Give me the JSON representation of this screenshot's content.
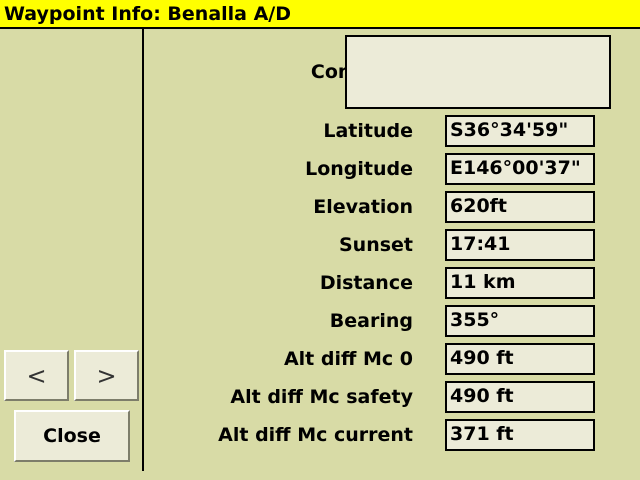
{
  "window": {
    "title": "Waypoint Info: Benalla A/D"
  },
  "nav": {
    "prev_label": "<",
    "next_label": ">",
    "close_label": "Close"
  },
  "comment": {
    "label": "Comment",
    "value": ""
  },
  "fields": [
    {
      "label": "Latitude",
      "value": "S36°34'59\""
    },
    {
      "label": "Longitude",
      "value": "E146°00'37\""
    },
    {
      "label": "Elevation",
      "value": "620ft"
    },
    {
      "label": "Sunset",
      "value": "17:41"
    },
    {
      "label": "Distance",
      "value": "11 km"
    },
    {
      "label": "Bearing",
      "value": "355°"
    },
    {
      "label": "Alt diff Mc 0",
      "value": "490 ft"
    },
    {
      "label": "Alt diff Mc safety",
      "value": "490 ft"
    },
    {
      "label": "Alt diff Mc current",
      "value": "371 ft"
    }
  ]
}
